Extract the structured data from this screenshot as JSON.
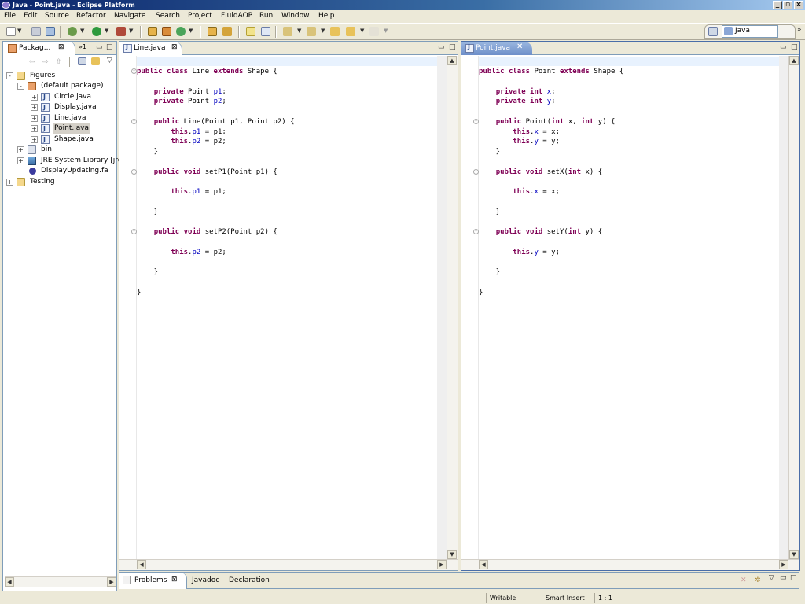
{
  "window": {
    "title": "Java - Point.java - Eclipse Platform"
  },
  "menu": [
    "File",
    "Edit",
    "Source",
    "Refactor",
    "Navigate",
    "Search",
    "Project",
    "FluidAOP",
    "Run",
    "Window",
    "Help"
  ],
  "perspective": {
    "label": "Java"
  },
  "package_explorer": {
    "tab_label": "Packag...",
    "overflow_label": "»1",
    "tree": {
      "figures": "Figures",
      "default_package": "(default package)",
      "circle": "Circle.java",
      "display": "Display.java",
      "line": "Line.java",
      "point": "Point.java",
      "shape": "Shape.java",
      "bin": "bin",
      "jre": "JRE System Library [jre",
      "display_updating": "DisplayUpdating.fa",
      "testing": "Testing"
    }
  },
  "editors": {
    "left": {
      "tab_label": "Line.java",
      "code": [
        [
          [
            "kw",
            "public "
          ],
          [
            "kw",
            "class "
          ],
          [
            "t",
            "Line "
          ],
          [
            "kw",
            "extends "
          ],
          [
            "t",
            "Shape {"
          ]
        ],
        [],
        [
          [
            "t",
            "    "
          ],
          [
            "kw",
            "private "
          ],
          [
            "t",
            "Point "
          ],
          [
            "fld",
            "p1"
          ],
          [
            "t",
            ";"
          ]
        ],
        [
          [
            "t",
            "    "
          ],
          [
            "kw",
            "private "
          ],
          [
            "t",
            "Point "
          ],
          [
            "fld",
            "p2"
          ],
          [
            "t",
            ";"
          ]
        ],
        [],
        [
          [
            "t",
            "    "
          ],
          [
            "kw",
            "public "
          ],
          [
            "t",
            "Line(Point p1, Point p2) {"
          ]
        ],
        [
          [
            "t",
            "        "
          ],
          [
            "kw",
            "this"
          ],
          [
            "t",
            "."
          ],
          [
            "fld",
            "p1"
          ],
          [
            "t",
            " = p1;"
          ]
        ],
        [
          [
            "t",
            "        "
          ],
          [
            "kw",
            "this"
          ],
          [
            "t",
            "."
          ],
          [
            "fld",
            "p2"
          ],
          [
            "t",
            " = p2;"
          ]
        ],
        [
          [
            "t",
            "    }"
          ]
        ],
        [],
        [
          [
            "t",
            "    "
          ],
          [
            "kw",
            "public "
          ],
          [
            "kw",
            "void "
          ],
          [
            "t",
            "setP1(Point p1) {"
          ]
        ],
        [],
        [
          [
            "t",
            "        "
          ],
          [
            "kw",
            "this"
          ],
          [
            "t",
            "."
          ],
          [
            "fld",
            "p1"
          ],
          [
            "t",
            " = p1;"
          ]
        ],
        [],
        [
          [
            "t",
            "    }"
          ]
        ],
        [],
        [
          [
            "t",
            "    "
          ],
          [
            "kw",
            "public "
          ],
          [
            "kw",
            "void "
          ],
          [
            "t",
            "setP2(Point p2) {"
          ]
        ],
        [],
        [
          [
            "t",
            "        "
          ],
          [
            "kw",
            "this"
          ],
          [
            "t",
            "."
          ],
          [
            "fld",
            "p2"
          ],
          [
            "t",
            " = p2;"
          ]
        ],
        [],
        [
          [
            "t",
            "    }"
          ]
        ],
        [],
        [
          [
            "t",
            "}"
          ]
        ]
      ]
    },
    "right": {
      "tab_label": "Point.java",
      "code": [
        [
          [
            "kw",
            "public "
          ],
          [
            "kw",
            "class "
          ],
          [
            "t",
            "Point "
          ],
          [
            "kw",
            "extends "
          ],
          [
            "t",
            "Shape {"
          ]
        ],
        [],
        [
          [
            "t",
            "    "
          ],
          [
            "kw",
            "private "
          ],
          [
            "kw",
            "int "
          ],
          [
            "fld",
            "x"
          ],
          [
            "t",
            ";"
          ]
        ],
        [
          [
            "t",
            "    "
          ],
          [
            "kw",
            "private "
          ],
          [
            "kw",
            "int "
          ],
          [
            "fld",
            "y"
          ],
          [
            "t",
            ";"
          ]
        ],
        [],
        [
          [
            "t",
            "    "
          ],
          [
            "kw",
            "public "
          ],
          [
            "t",
            "Point("
          ],
          [
            "kw",
            "int "
          ],
          [
            "t",
            "x, "
          ],
          [
            "kw",
            "int "
          ],
          [
            "t",
            "y) {"
          ]
        ],
        [
          [
            "t",
            "        "
          ],
          [
            "kw",
            "this"
          ],
          [
            "t",
            "."
          ],
          [
            "fld",
            "x"
          ],
          [
            "t",
            " = x;"
          ]
        ],
        [
          [
            "t",
            "        "
          ],
          [
            "kw",
            "this"
          ],
          [
            "t",
            "."
          ],
          [
            "fld",
            "y"
          ],
          [
            "t",
            " = y;"
          ]
        ],
        [
          [
            "t",
            "    }"
          ]
        ],
        [],
        [
          [
            "t",
            "    "
          ],
          [
            "kw",
            "public "
          ],
          [
            "kw",
            "void "
          ],
          [
            "t",
            "setX("
          ],
          [
            "kw",
            "int "
          ],
          [
            "t",
            "x) {"
          ]
        ],
        [],
        [
          [
            "t",
            "        "
          ],
          [
            "kw",
            "this"
          ],
          [
            "t",
            "."
          ],
          [
            "fld",
            "x"
          ],
          [
            "t",
            " = x;"
          ]
        ],
        [],
        [
          [
            "t",
            "    }"
          ]
        ],
        [],
        [
          [
            "t",
            "    "
          ],
          [
            "kw",
            "public "
          ],
          [
            "kw",
            "void "
          ],
          [
            "t",
            "setY("
          ],
          [
            "kw",
            "int "
          ],
          [
            "t",
            "y) {"
          ]
        ],
        [],
        [
          [
            "t",
            "        "
          ],
          [
            "kw",
            "this"
          ],
          [
            "t",
            "."
          ],
          [
            "fld",
            "y"
          ],
          [
            "t",
            " = y;"
          ]
        ],
        [],
        [
          [
            "t",
            "    }"
          ]
        ],
        [],
        [
          [
            "t",
            "}"
          ]
        ]
      ]
    }
  },
  "bottom_tabs": {
    "problems": "Problems",
    "javadoc": "Javadoc",
    "declaration": "Declaration"
  },
  "status": {
    "writable": "Writable",
    "insert_mode": "Smart Insert",
    "position": "1 : 1"
  }
}
